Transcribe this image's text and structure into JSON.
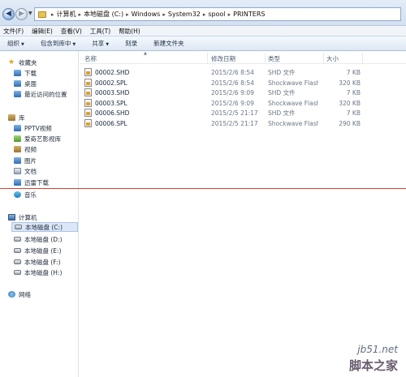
{
  "address_bar": {
    "breadcrumbs": [
      "计算机",
      "本地磁盘 (C:)",
      "Windows",
      "System32",
      "spool",
      "PRINTERS"
    ]
  },
  "menu": [
    "文件(F)",
    "编辑(E)",
    "查看(V)",
    "工具(T)",
    "帮助(H)"
  ],
  "toolbar": {
    "organize": "组织",
    "include_library": "包含到库中",
    "share": "共享",
    "burn": "刻录",
    "new_folder": "新建文件夹"
  },
  "nav": {
    "favorites": "收藏夹",
    "favorites_items": [
      "下载",
      "桌面",
      "最近访问的位置"
    ],
    "libraries": "库",
    "library_items": [
      "PPTV视频",
      "爱奇艺影视库",
      "视频",
      "图片",
      "文档",
      "迅雷下载",
      "音乐"
    ],
    "computer": "计算机",
    "drives": [
      "本地磁盘 (C:)",
      "本地磁盘 (D:)",
      "本地磁盘 (E:)",
      "本地磁盘 (F:)",
      "本地磁盘 (H:)"
    ],
    "network": "网络"
  },
  "columns": {
    "name": "名称",
    "date": "修改日期",
    "type": "类型",
    "size": "大小"
  },
  "files": [
    {
      "name": "00002.SHD",
      "date": "2015/2/6 8:54",
      "type": "SHD 文件",
      "size": "7 KB"
    },
    {
      "name": "00002.SPL",
      "date": "2015/2/6 8:54",
      "type": "Shockwave Flash...",
      "size": "320 KB"
    },
    {
      "name": "00003.SHD",
      "date": "2015/2/6 9:09",
      "type": "SHD 文件",
      "size": "7 KB"
    },
    {
      "name": "00003.SPL",
      "date": "2015/2/6 9:09",
      "type": "Shockwave Flash...",
      "size": "320 KB"
    },
    {
      "name": "00006.SHD",
      "date": "2015/2/5 21:17",
      "type": "SHD 文件",
      "size": "7 KB"
    },
    {
      "name": "00006.SPL",
      "date": "2015/2/5 21:17",
      "type": "Shockwave Flash...",
      "size": "290 KB"
    }
  ],
  "watermark": {
    "url": "jb51.net",
    "brand": "脚本之家"
  },
  "colors": {
    "annotation_line": "#e03a2c",
    "selection": "#dbe7f7"
  }
}
